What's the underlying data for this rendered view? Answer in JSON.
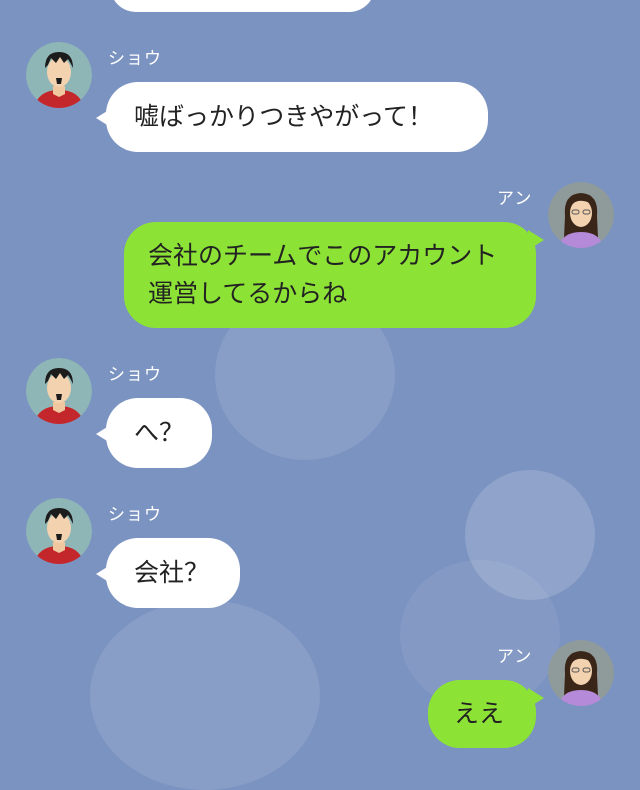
{
  "messages": [
    {
      "sender": "ショウ",
      "text": "嘘ばっかりつきやがって！"
    },
    {
      "sender": "アン",
      "text": "会社のチームでこのアカウント運営してるからね"
    },
    {
      "sender": "ショウ",
      "text": "へ？"
    },
    {
      "sender": "ショウ",
      "text": "会社？"
    },
    {
      "sender": "アン",
      "text": "ええ"
    }
  ],
  "colors": {
    "background": "#7b93c1",
    "incoming_bubble": "#ffffff",
    "outgoing_bubble": "#8de236",
    "name_text": "#ffffff"
  }
}
